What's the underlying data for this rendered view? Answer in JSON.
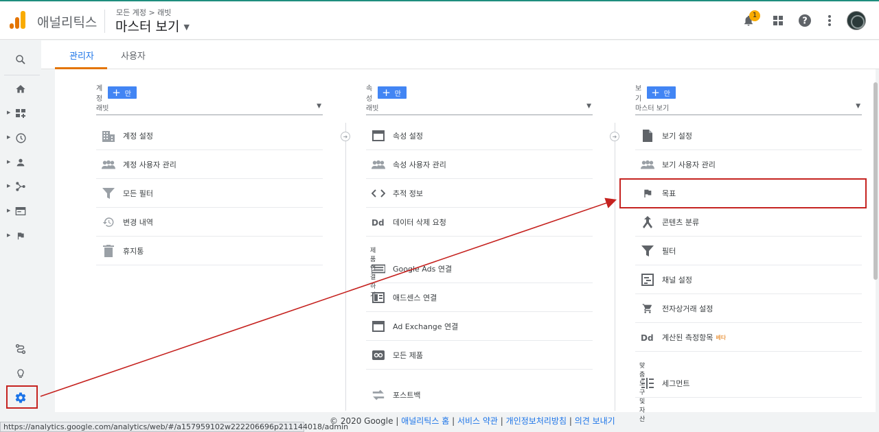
{
  "header": {
    "app_name": "애널리틱스",
    "breadcrumb": "모든 계정 > 래빗",
    "view_name": "마스터 보기",
    "notification_count": "1",
    "icons": [
      "bell-icon",
      "apps-grid-icon",
      "help-icon",
      "more-vert-icon"
    ]
  },
  "tabs": [
    {
      "label": "관리자",
      "active": true
    },
    {
      "label": "사용자",
      "active": false
    }
  ],
  "rail": {
    "items": [
      "search-icon",
      "home-icon",
      "customization-icon",
      "realtime-icon",
      "audience-icon",
      "acquisition-icon",
      "behavior-icon",
      "conversions-icon"
    ],
    "bottom": [
      "attribution-icon",
      "discover-icon",
      "admin-gear-icon"
    ]
  },
  "columns": {
    "account": {
      "label": "계정",
      "create_label": "계정 만들기",
      "selected": "래빗",
      "items": [
        {
          "label": "계정 설정",
          "icon": "building-icon"
        },
        {
          "label": "계정 사용자 관리",
          "icon": "people-icon"
        },
        {
          "label": "모든 필터",
          "icon": "filter-icon"
        },
        {
          "label": "변경 내역",
          "icon": "history-icon"
        },
        {
          "label": "휴지통",
          "icon": "trash-icon"
        }
      ]
    },
    "property": {
      "label": "속성",
      "create_label": "속성 만들기",
      "selected": "래빗",
      "items": [
        {
          "label": "속성 설정",
          "icon": "window-icon"
        },
        {
          "label": "속성 사용자 관리",
          "icon": "people-icon"
        },
        {
          "label": "추적 정보",
          "icon": "code-icon"
        },
        {
          "label": "데이터 삭제 요청",
          "icon": "dd-icon"
        }
      ],
      "section_title": "제품 연결하기",
      "link_items": [
        {
          "label": "Google Ads 연결",
          "icon": "ads-icon"
        },
        {
          "label": "애드센스 연결",
          "icon": "adsense-icon"
        },
        {
          "label": "Ad Exchange 연결",
          "icon": "window-icon"
        },
        {
          "label": "모든 제품",
          "icon": "link-icon"
        }
      ],
      "postback": "포스트백"
    },
    "view": {
      "label": "보기",
      "create_label": "보기 만들기",
      "selected": "마스터 보기",
      "items": [
        {
          "label": "보기 설정",
          "icon": "document-icon"
        },
        {
          "label": "보기 사용자 관리",
          "icon": "people-icon"
        },
        {
          "label": "목표",
          "icon": "flag-icon"
        },
        {
          "label": "콘텐츠 분류",
          "icon": "grouping-icon"
        },
        {
          "label": "필터",
          "icon": "filter-icon"
        },
        {
          "label": "채널 설정",
          "icon": "channel-icon"
        },
        {
          "label": "전자상거래 설정",
          "icon": "cart-icon"
        },
        {
          "label": "계산된 측정항목",
          "icon": "dd-icon",
          "badge": "베타"
        }
      ],
      "section_title": "맞춤 도구 및 자산",
      "tool_items": [
        {
          "label": "세그먼트",
          "icon": "segment-icon"
        }
      ]
    }
  },
  "footer": {
    "copyright": "© 2020 Google",
    "sep": "|",
    "links": [
      "애널리틱스 홈",
      "서비스 약관",
      "개인정보처리방침",
      "의견 보내기"
    ]
  },
  "status_url": "https://analytics.google.com/analytics/web/#/a157959102w222206696p211144018/admin",
  "colors": {
    "accent_blue": "#4285f4",
    "tab_underline": "#e37400",
    "annotation_red": "#c5221f"
  }
}
